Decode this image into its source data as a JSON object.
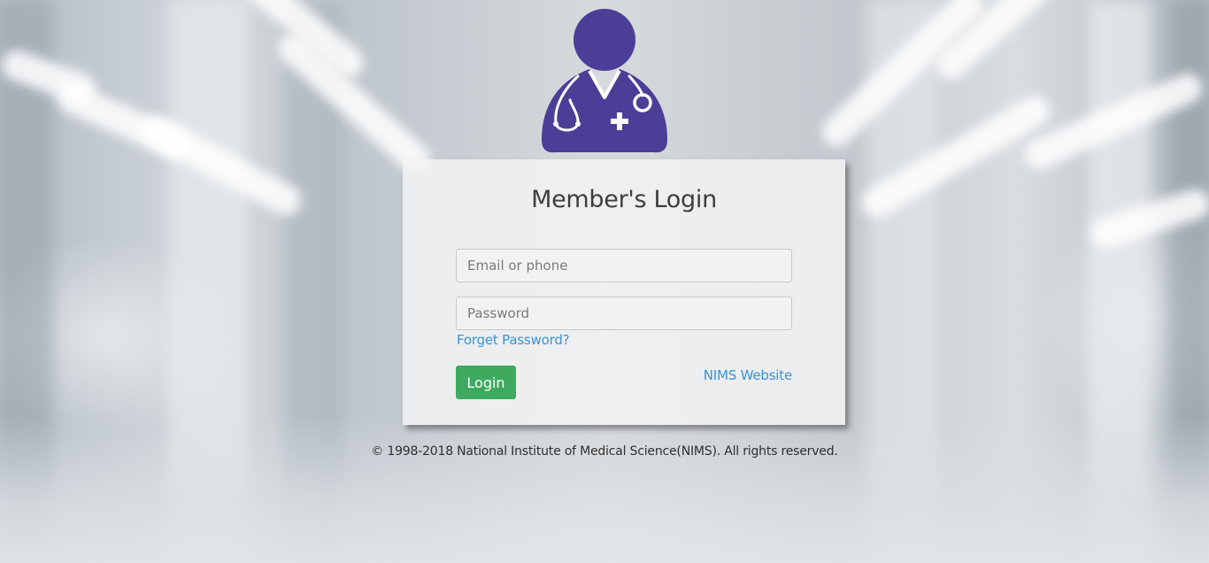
{
  "brand": {
    "accent_color": "#4c3d96",
    "success_color": "#3daa5f",
    "link_color": "#3593d9",
    "avatar_icon": "doctor-icon"
  },
  "login": {
    "title": "Member's Login",
    "email_placeholder": "Email or phone",
    "password_placeholder": "Password",
    "forgot_password_label": "Forget Password?",
    "login_button_label": "Login",
    "website_link_label": "NIMS Website"
  },
  "footer": {
    "copyright": "© 1998-2018 National Institute of Medical Science(NIMS). All rights reserved."
  }
}
